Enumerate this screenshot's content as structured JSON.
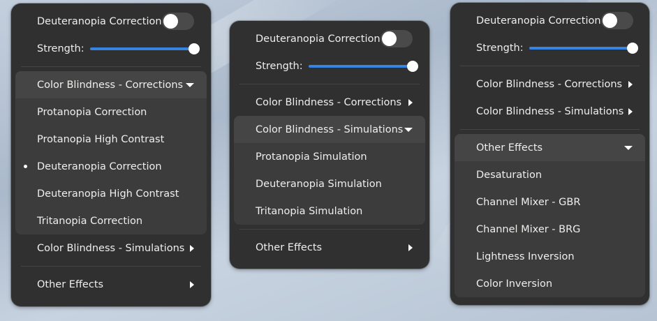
{
  "panels": [
    {
      "toggle_label": "Deuteranopia Correction",
      "strength_label": "Strength:",
      "menus": {
        "corrections": {
          "label": "Color Blindness - Corrections",
          "items": [
            "Protanopia Correction",
            "Protanopia High Contrast",
            "Deuteranopia Correction",
            "Deuteranopia High Contrast",
            "Tritanopia Correction"
          ]
        },
        "simulations": {
          "label": "Color Blindness - Simulations"
        },
        "other": {
          "label": "Other Effects"
        }
      }
    },
    {
      "toggle_label": "Deuteranopia Correction",
      "strength_label": "Strength:",
      "menus": {
        "corrections": {
          "label": "Color Blindness - Corrections"
        },
        "simulations": {
          "label": "Color Blindness - Simulations",
          "items": [
            "Protanopia Simulation",
            "Deuteranopia Simulation",
            "Tritanopia Simulation"
          ]
        },
        "other": {
          "label": "Other Effects"
        }
      }
    },
    {
      "toggle_label": "Deuteranopia Correction",
      "strength_label": "Strength:",
      "menus": {
        "corrections": {
          "label": "Color Blindness - Corrections"
        },
        "simulations": {
          "label": "Color Blindness - Simulations"
        },
        "other": {
          "label": "Other Effects",
          "items": [
            "Desaturation",
            "Channel Mixer - GBR",
            "Channel Mixer - BRG",
            "Lightness Inversion",
            "Color Inversion"
          ]
        }
      }
    }
  ],
  "colors": {
    "accent": "#3584e4",
    "panel_bg": "#303030",
    "submenu_bg": "#3c3c3c"
  }
}
